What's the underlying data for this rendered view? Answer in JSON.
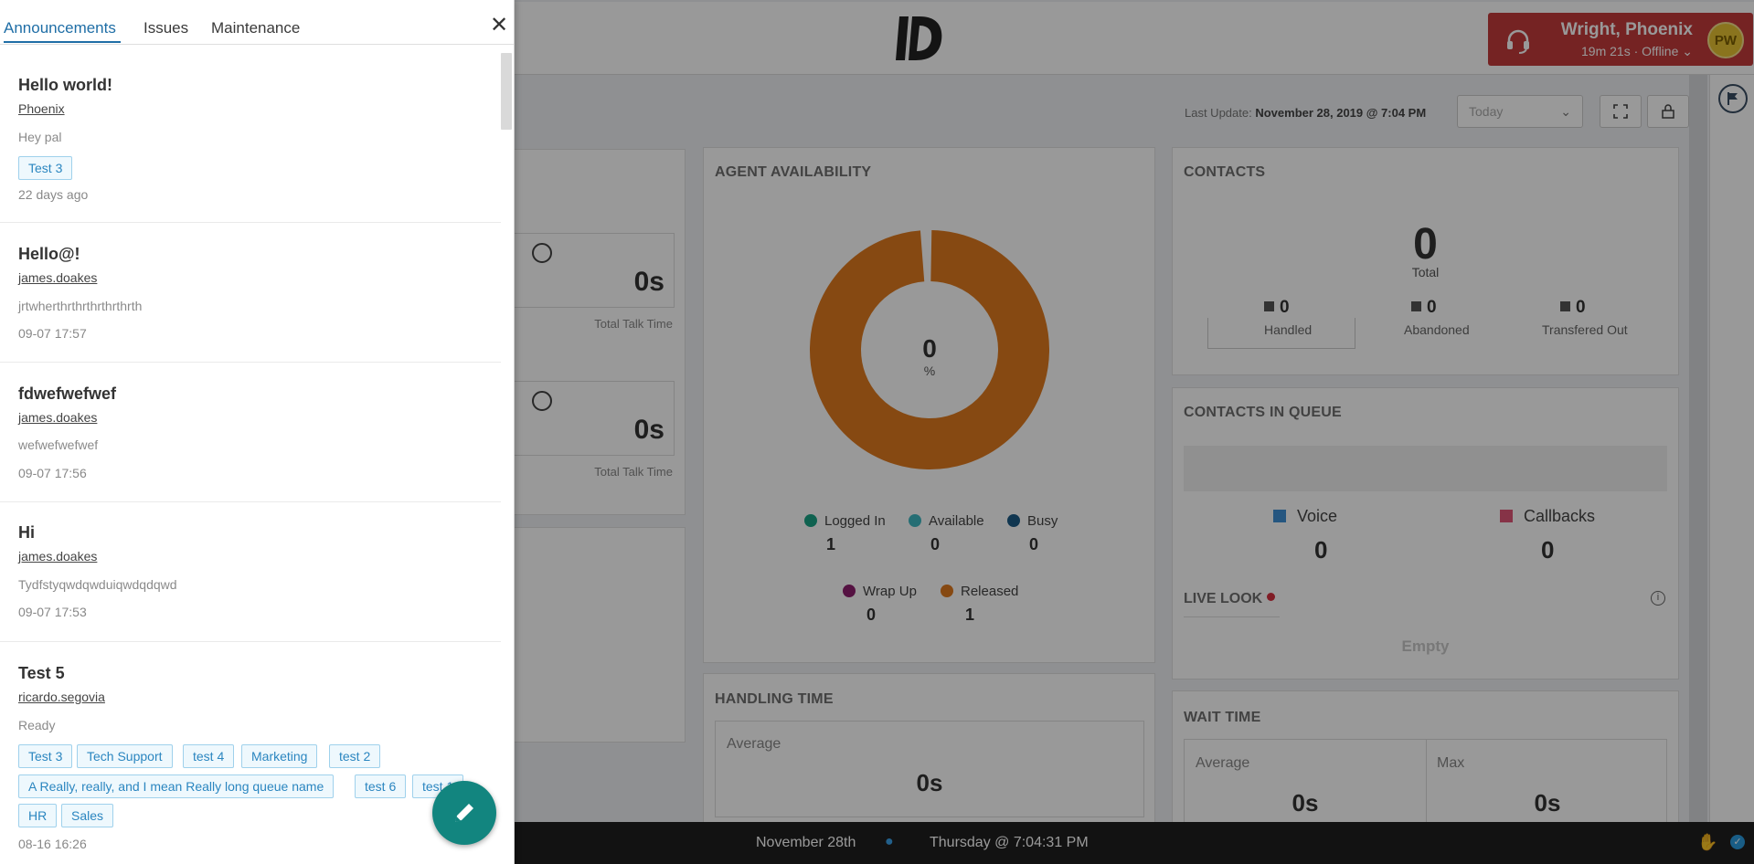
{
  "header": {
    "agent_name": "Wright, Phoenix",
    "agent_status": "19m 21s · Offline",
    "avatar_initials": "PW",
    "badge_color": "#c43b3b"
  },
  "subheader": {
    "last_update_label": "Last Update:",
    "last_update_value": "November 28, 2019 @ 7:04 PM",
    "range_value": "Today"
  },
  "cards": {
    "left_top": {
      "metric_1_value": "0s",
      "metric_1_label": "Total Talk Time",
      "metric_2_value": "0s",
      "metric_2_label": "Total Talk Time"
    },
    "agent_availability": {
      "title": "AGENT AVAILABILITY",
      "center_value": "0",
      "center_unit": "%",
      "legend": [
        {
          "label": "Logged In",
          "value": "1",
          "color": "#1aa386"
        },
        {
          "label": "Available",
          "value": "0",
          "color": "#3fb8c2"
        },
        {
          "label": "Busy",
          "value": "0",
          "color": "#1c5a85"
        },
        {
          "label": "Wrap Up",
          "value": "0",
          "color": "#8e1f6e"
        },
        {
          "label": "Released",
          "value": "1",
          "color": "#e07a1f"
        }
      ]
    },
    "contacts": {
      "title": "CONTACTS",
      "total_value": "0",
      "total_label": "Total",
      "stats": [
        {
          "value": "0",
          "label": "Handled"
        },
        {
          "value": "0",
          "label": "Abandoned"
        },
        {
          "value": "0",
          "label": "Transfered Out"
        }
      ]
    },
    "contacts_in_queue": {
      "title": "CONTACTS IN QUEUE",
      "voice_label": "Voice",
      "voice_value": "0",
      "voice_color": "#3f8fd6",
      "callbacks_label": "Callbacks",
      "callbacks_value": "0",
      "callbacks_color": "#e05677",
      "live_look_label": "LIVE LOOK",
      "empty_label": "Empty"
    },
    "handling_time": {
      "title": "HANDLING TIME",
      "average_label": "Average",
      "average_value": "0s"
    },
    "wait_time": {
      "title": "WAIT TIME",
      "average_label": "Average",
      "average_value": "0s",
      "max_label": "Max",
      "max_value": "0s"
    }
  },
  "footer": {
    "date": "November 28th",
    "time": "Thursday @ 7:04:31 PM"
  },
  "panel": {
    "tabs": [
      "Announcements",
      "Issues",
      "Maintenance"
    ],
    "active_tab": "Announcements",
    "items": [
      {
        "title": "Hello world!",
        "author": "Phoenix",
        "body": "Hey pal",
        "tags": [
          "Test 3"
        ],
        "time": "22 days ago"
      },
      {
        "title": "Hello@!",
        "author": "james.doakes",
        "body": "jrtwherthrthrthrthrthrth",
        "tags": [],
        "time": "09-07 17:57"
      },
      {
        "title": "fdwefwefwef",
        "author": "james.doakes",
        "body": "wefwefwefwef",
        "tags": [],
        "time": "09-07 17:56"
      },
      {
        "title": "Hi",
        "author": "james.doakes",
        "body": "Tydfstyqwdqwduiqwdqdqwd",
        "tags": [],
        "time": "09-07 17:53"
      },
      {
        "title": "Test 5",
        "author": "ricardo.segovia",
        "body": "Ready",
        "tags": [
          "Test 3",
          "Tech Support",
          "test 4",
          "Marketing",
          "test 2",
          "A Really, really, and I mean Really long queue name",
          "test 6",
          "test 1",
          "HR",
          "Sales"
        ],
        "time": "08-16 16:26"
      }
    ]
  }
}
